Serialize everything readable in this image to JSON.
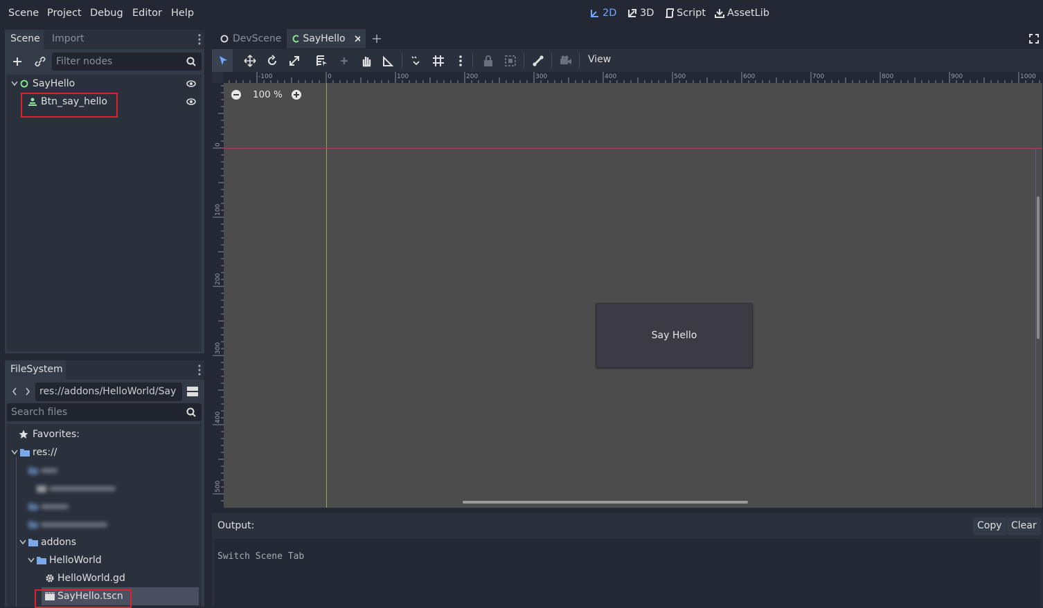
{
  "menu": [
    "Scene",
    "Project",
    "Debug",
    "Editor",
    "Help"
  ],
  "workspaces": [
    {
      "label": "2D",
      "icon": "2d-icon",
      "active": true
    },
    {
      "label": "3D",
      "icon": "3d-icon",
      "active": false
    },
    {
      "label": "Script",
      "icon": "script-icon",
      "active": false
    },
    {
      "label": "AssetLib",
      "icon": "assetlib-icon",
      "active": false
    }
  ],
  "scene_dock": {
    "tabs": [
      "Scene",
      "Import"
    ],
    "filter_placeholder": "Filter nodes",
    "nodes": [
      {
        "label": "SayHello",
        "icon": "node-circle-icon"
      },
      {
        "label": "Btn_say_hello",
        "icon": "button-node-icon"
      }
    ]
  },
  "filesystem_dock": {
    "title": "FileSystem",
    "path": "res://addons/HelloWorld/Say",
    "search_placeholder": "Search files",
    "favorites": "Favorites:",
    "root": "res://",
    "items": {
      "addons": "addons",
      "helloworld": "HelloWorld",
      "gd": "HelloWorld.gd",
      "tscn": "SayHello.tscn"
    }
  },
  "editor_tabs": [
    {
      "label": "DevScene",
      "active": false
    },
    {
      "label": "SayHello",
      "active": true
    }
  ],
  "toolbar": {
    "view_label": "View"
  },
  "viewport": {
    "zoom": "100 %",
    "ruler_x": [
      "-100",
      "0",
      "100",
      "200",
      "300",
      "400",
      "500",
      "600",
      "700",
      "800",
      "900",
      "1000"
    ],
    "ruler_y": [
      "0",
      "100",
      "200",
      "300",
      "400",
      "500"
    ],
    "button_text": "Say Hello"
  },
  "output": {
    "title": "Output:",
    "copy": "Copy",
    "clear": "Clear",
    "log": "Switch Scene Tab"
  },
  "colors": {
    "accent": "#70a8ff",
    "highlight_box": "#e0202a",
    "viewport_bg": "#4c4c4c"
  }
}
